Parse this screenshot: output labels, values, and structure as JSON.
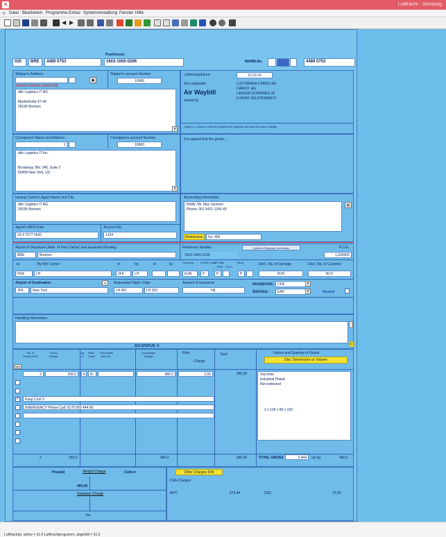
{
  "window": {
    "title": "Luftfracht - Sendung"
  },
  "menu": [
    "Datei",
    "Bearbeiten",
    "Programme",
    "Extras",
    "Systemverwaltung",
    "Fenster",
    "Hilfe"
  ],
  "header": {
    "prefix": "020",
    "origin_code": "BRE",
    "awb_no": "4489 0753",
    "position_label": "Positionsnr.",
    "position_no": "1603-1000-0296",
    "awb_label": "MAWB-No.",
    "awb_no2": "4489 0753"
  },
  "shipper": {
    "label": "Shipper's Address",
    "account_label": "Shipper's account Number",
    "account": "10066",
    "red_note": "ABWEICHENDE ADRESSE",
    "lines": "dkh Logistics IT AG\n\nMarktstraße 47-49\n28195 Bremen"
  },
  "issue": {
    "date_label": "Lieferungsdatum:",
    "date": "12.03.16",
    "not_negotiable": "Not negotiable",
    "air_waybill": "Air Waybill",
    "issued_by": "issued by",
    "issuer": "LUFTHANSA CARGO AG\nCARGO  AG\nLANGER KORNWEG 34\nD-65451 KELSTERBACH",
    "copies_note": "Copies 1, 2 and 3 of this Air Waybill are originals and have the same validity",
    "agreed_note": "It is agreed that the goods..."
  },
  "consignee": {
    "label": "Consignee's Name and Address",
    "account_label": "Consignee's account Number",
    "account": "10660",
    "stepper": "2",
    "lines": "dkh Logistics IT Inc.\n\n\nBroadway, Bld. 345, Suite 2\n60458 New York, US"
  },
  "agent": {
    "label": "Issuing Carrier's Agent Name and City",
    "lines": "dkh Logistics IT AG\n28195 Bremen",
    "iata_label": "Agent's IATA Code",
    "iata": "23-4 7077 5542",
    "account_label": "Account No.",
    "account": "1234"
  },
  "accounting": {
    "label": "Accounting Information",
    "lines": "Notify: Mr. Max Jackson\nPhone: 001 5421 1245 45",
    "ref_button": "Referenzen",
    "ref_value": "Inv. 456"
  },
  "routing": {
    "departure_label": "Airport of Departure (Addr. of First Carrier) and requested Routing",
    "departure_code": "BRE",
    "departure_city": "Bremen",
    "reference_label": "Reference Number",
    "reference": "1603-1000-0296",
    "optional_label": "Optional Shipping Information",
    "roe_label": "R.O.E.",
    "roe": "1,000000",
    "to_label": "to",
    "by_label": "By first Carrier",
    "by_label2": "by",
    "to1": "FRA",
    "by1": "LH",
    "to2": "JFK",
    "by2": "LH",
    "currency_label": "Currency",
    "chgs_label": "CHGS Code",
    "wtval_label": "WT/VAL",
    "other_label": "Other",
    "ppd": "PPD",
    "col": "COLL",
    "currency": "EUR",
    "chgs": "P",
    "wt_p": "P",
    "other_p": "P",
    "carriage_label": "Decl. Val. of Carriage",
    "customs_label": "Decl. Val. of Customs",
    "carriage": "NVD",
    "customs": "NCV",
    "dest_label": "Airport of Destination",
    "dest_code": "JFK",
    "dest_city": "New York",
    "flight_label": "Requested Flight / Date",
    "flight1": "LH 401",
    "flight2": "LH 352",
    "insurance_label": "Amount of Insurance",
    "insurance": "NIL",
    "incoterms_label": "Incoterms:",
    "incoterm": "CFR",
    "service_label": "Service:",
    "service": "EAP",
    "neutral_label": "Neutral"
  },
  "handling": {
    "label": "Handling Information",
    "sci": "SCI-STATUS: X",
    "sc_btn": "SC"
  },
  "rating": {
    "pcs_label": "No. of Pieces RCP",
    "gross_label": "Gross Weight",
    "kg_label": "kg lb",
    "rate_class_label": "Rate Class",
    "commodity_label": "Commodity Item No.",
    "chargeable_label": "Chargeable Weight",
    "rate_label": "Rate",
    "charge_label": "Charge",
    "total_label": "Total",
    "nature_label": "Nature and Quantity of Goods",
    "dims_button": "Dim. Dimensions or Volume",
    "row_pcs": "2",
    "row_gross": "250,0",
    "row_k": "K",
    "row_n": "N",
    "row_chargeable": "480,0",
    "row_rate": "2,00",
    "row_total": "960,00",
    "goods": "Vaccines\nIndustrial Plastic\nNot restricted",
    "dims": "2 x 120 x 80 x 150",
    "keep_cool": "Keep Cool !!!",
    "emergency": "EMERGENCY Phone Call: 0176 555 444 66",
    "sum_pcs": "2",
    "sum_gross": "250,0",
    "sum_chargeable": "480,0",
    "sum_total": "960,00",
    "total_gross_label": "TOTAL GROSS",
    "total_gross": "2,444",
    "kg": "kg",
    "volume_label": "vol kg",
    "volume": "480,0",
    "new_btn": "Neu"
  },
  "charges": {
    "prepaid_label": "Prepaid",
    "weight_charge_btn": "Weight Charge",
    "collect_label": "Collect",
    "prepaid_weight": "960,00",
    "valuation_btn": "Valuation Charge",
    "tax_label": "Tax",
    "other_charges_btn": "Other Charges (F8)",
    "fsa_label": "FSA-Charges",
    "oc1_code": "MYC",
    "oc1_amount": "575,44",
    "oc2_code": "SSC",
    "oc2_amount": "72,00"
  },
  "status": {
    "text": "Luftfrachtpr. aktive = 31.0   Luftfrachtprogramm. abgefüllt = 31.0"
  }
}
